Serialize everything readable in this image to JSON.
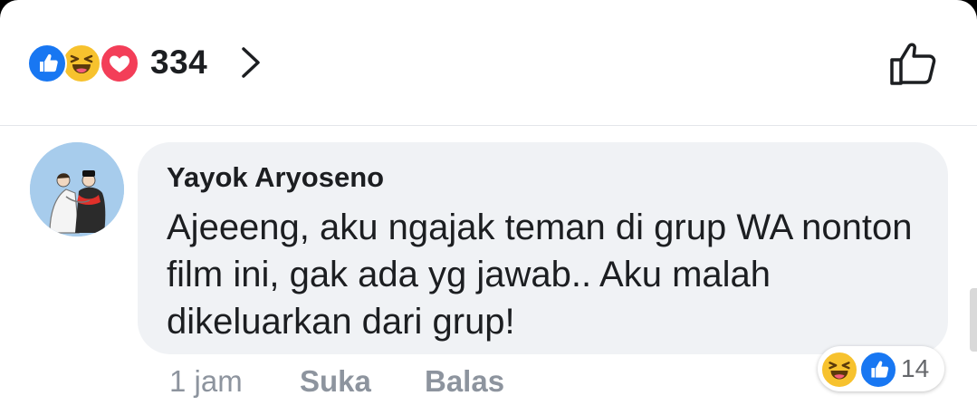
{
  "reactions": {
    "count": "334",
    "icons": [
      "like-icon",
      "haha-icon",
      "love-icon"
    ]
  },
  "comment": {
    "author": "Yayok Aryoseno",
    "text": "Ajeeeng, aku ngajak teman di grup WA nonton film ini, gak ada yg jawab.. Aku malah dikeluarkan dari grup!",
    "time": "1 jam",
    "like_label": "Suka",
    "reply_label": "Balas",
    "reaction_count": "14",
    "reaction_icons": [
      "haha-icon",
      "like-icon"
    ]
  },
  "colors": {
    "like": "#1877f2",
    "haha": "#f7c22e",
    "love": "#f33e58",
    "bubble": "#f0f2f5",
    "meta_text": "#8d949e"
  }
}
